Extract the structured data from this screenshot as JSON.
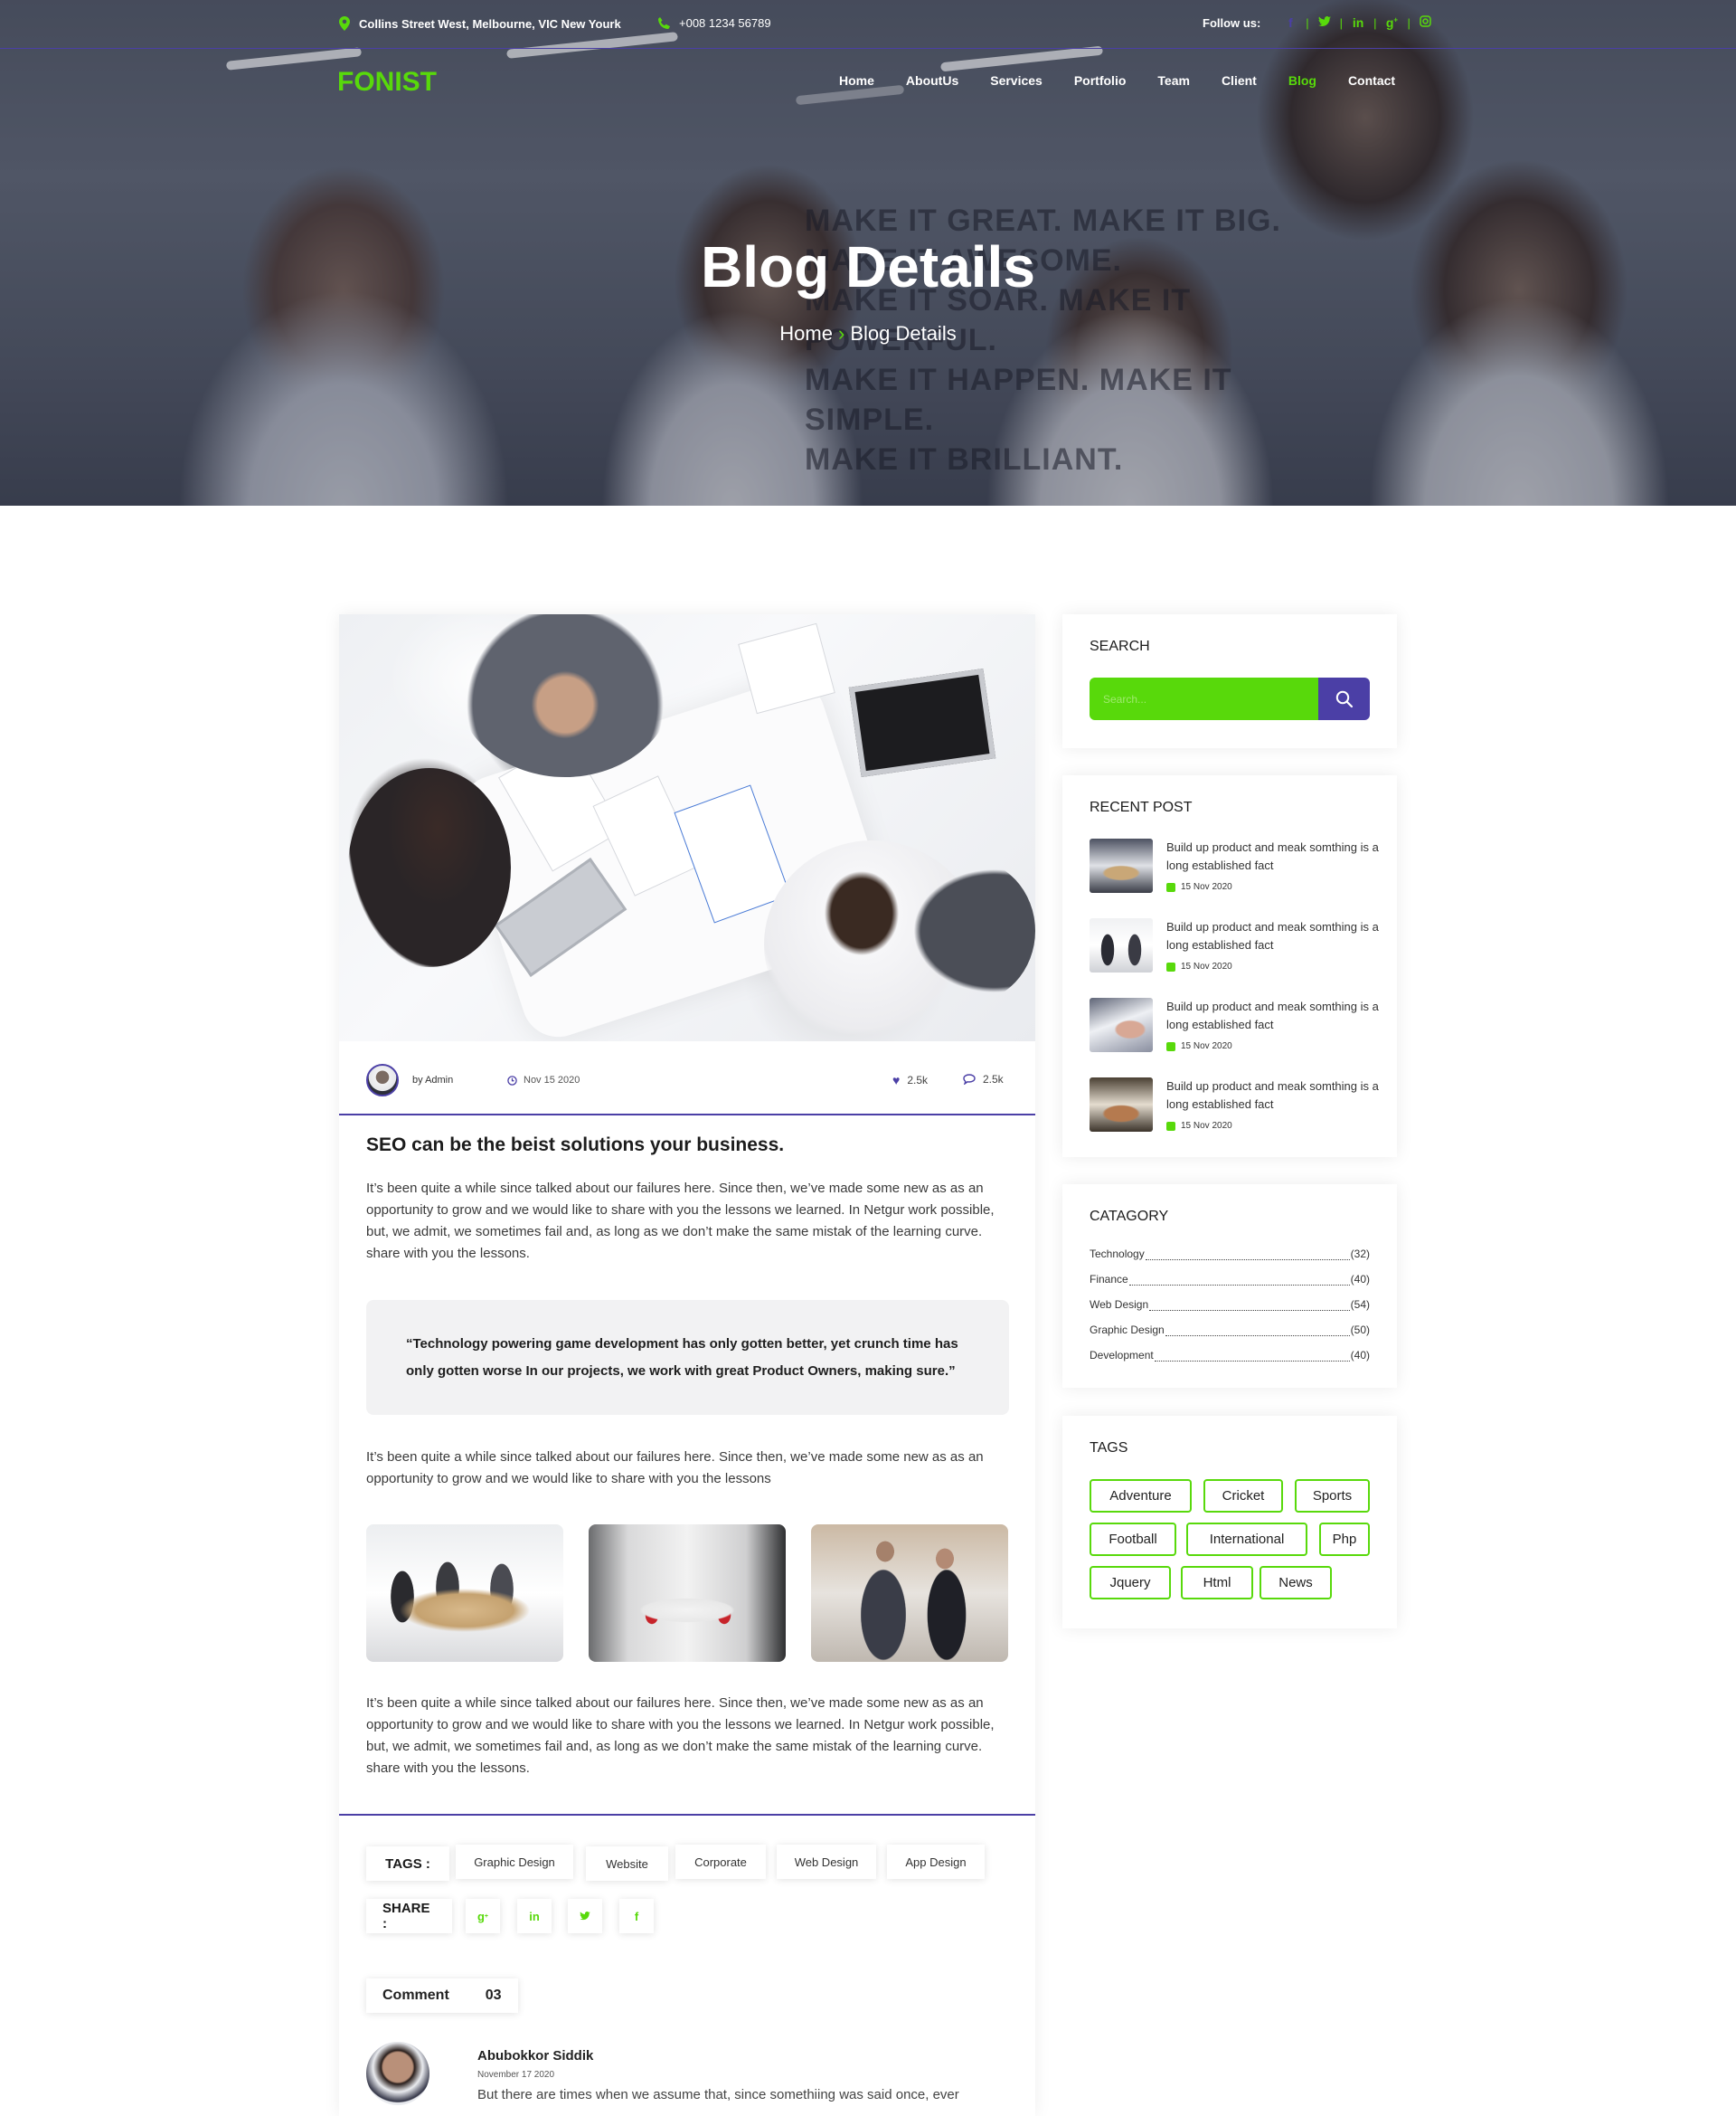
{
  "topbar": {
    "address": "Collins Street West, Melbourne, VIC New Yourk",
    "phone": "+008 1234 56789",
    "follow_label": "Follow us:",
    "social": [
      "f",
      "t",
      "in",
      "g+",
      "ig"
    ]
  },
  "brand": {
    "logo": "FONIST",
    "accent": "#58d90b",
    "primary": "#4b3fa6"
  },
  "nav": [
    {
      "label": "Home",
      "active": false
    },
    {
      "label": "AboutUs",
      "active": false
    },
    {
      "label": "Services",
      "active": false
    },
    {
      "label": "Portfolio",
      "active": false
    },
    {
      "label": "Team",
      "active": false
    },
    {
      "label": "Client",
      "active": false
    },
    {
      "label": "Blog",
      "active": true
    },
    {
      "label": "Contact",
      "active": false
    }
  ],
  "hero": {
    "title": "Blog Details",
    "breadcrumb_home": "Home",
    "breadcrumb_current": "Blog Details",
    "wall_lines": [
      "MAKE IT GREAT. MAKE IT BIG.",
      "MAKE IT AWESOME.",
      "MAKE IT SOAR. MAKE IT POWERFUL.",
      "MAKE IT HAPPEN. MAKE IT SIMPLE.",
      "MAKE IT BRILLIANT."
    ]
  },
  "post": {
    "author": "by Admin",
    "date": "Nov 15 2020",
    "likes": "2.5k",
    "comments": "2.5k",
    "title": "SEO can be the beist solutions your business.",
    "para1": "It’s been quite a while since talked about our failures here. Since then, we’ve made some new as as an opportunity to grow and we would like to share with you the lessons we learned. In Netgur work possible, but, we admit, we sometimes fail and, as long as we don’t make the same mistak of the learning curve. share with you the lessons.",
    "quote": "“Technology powering game development has only gotten better, yet crunch time has only gotten worse In our projects, we work with great Product Owners, making sure.”",
    "para2": "It’s been quite a while since talked about our failures here. Since then, we’ve made some new as as an opportunity to grow and we would like to share with you the lessons",
    "para3": "It’s been quite a while since talked about our failures here. Since then, we’ve made some new as as an opportunity to grow and we would like to share with you the lessons we learned. In Netgur work possible, but, we admit, we sometimes fail and, as long as we don’t make the same mistak of the learning curve. share with you the lessons.",
    "tags_label": "TAGS :",
    "tags": [
      "Graphic Design",
      "Website",
      "Corporate",
      "Web Design",
      "App Design"
    ],
    "share_label": "SHARE :",
    "share_icons": [
      "g+",
      "in",
      "t",
      "f"
    ],
    "comment_label": "Comment",
    "comment_count": "03",
    "comment": {
      "name": "Abubokkor Siddik",
      "date": "November 17 2020",
      "text": "But there are times when we assume that, since somethiing was said once, ever"
    }
  },
  "sidebar": {
    "search_title": "SEARCH",
    "search_placeholder": "Search...",
    "recent_title": "RECENT POST",
    "recent": [
      {
        "text": "Build up product and meak somthing is a long established fact",
        "date": "15 Nov 2020"
      },
      {
        "text": "Build up product and meak somthing is a long established fact",
        "date": "15 Nov 2020"
      },
      {
        "text": "Build up product and meak somthing is a long established fact",
        "date": "15 Nov 2020"
      },
      {
        "text": "Build up product and meak somthing is a long established fact",
        "date": "15 Nov 2020"
      }
    ],
    "category_title": "CATAGORY",
    "categories": [
      {
        "name": "Technology",
        "count": "(32)"
      },
      {
        "name": "Finance",
        "count": "(40)"
      },
      {
        "name": "Web Design",
        "count": "(54)"
      },
      {
        "name": "Graphic Design",
        "count": "(50)"
      },
      {
        "name": "Development",
        "count": "(40)"
      }
    ],
    "tags_title": "TAGS",
    "tags": [
      "Adventure",
      "Cricket",
      "Sports",
      "Football",
      "International",
      "Php",
      "Jquery",
      "Html",
      "News"
    ]
  }
}
